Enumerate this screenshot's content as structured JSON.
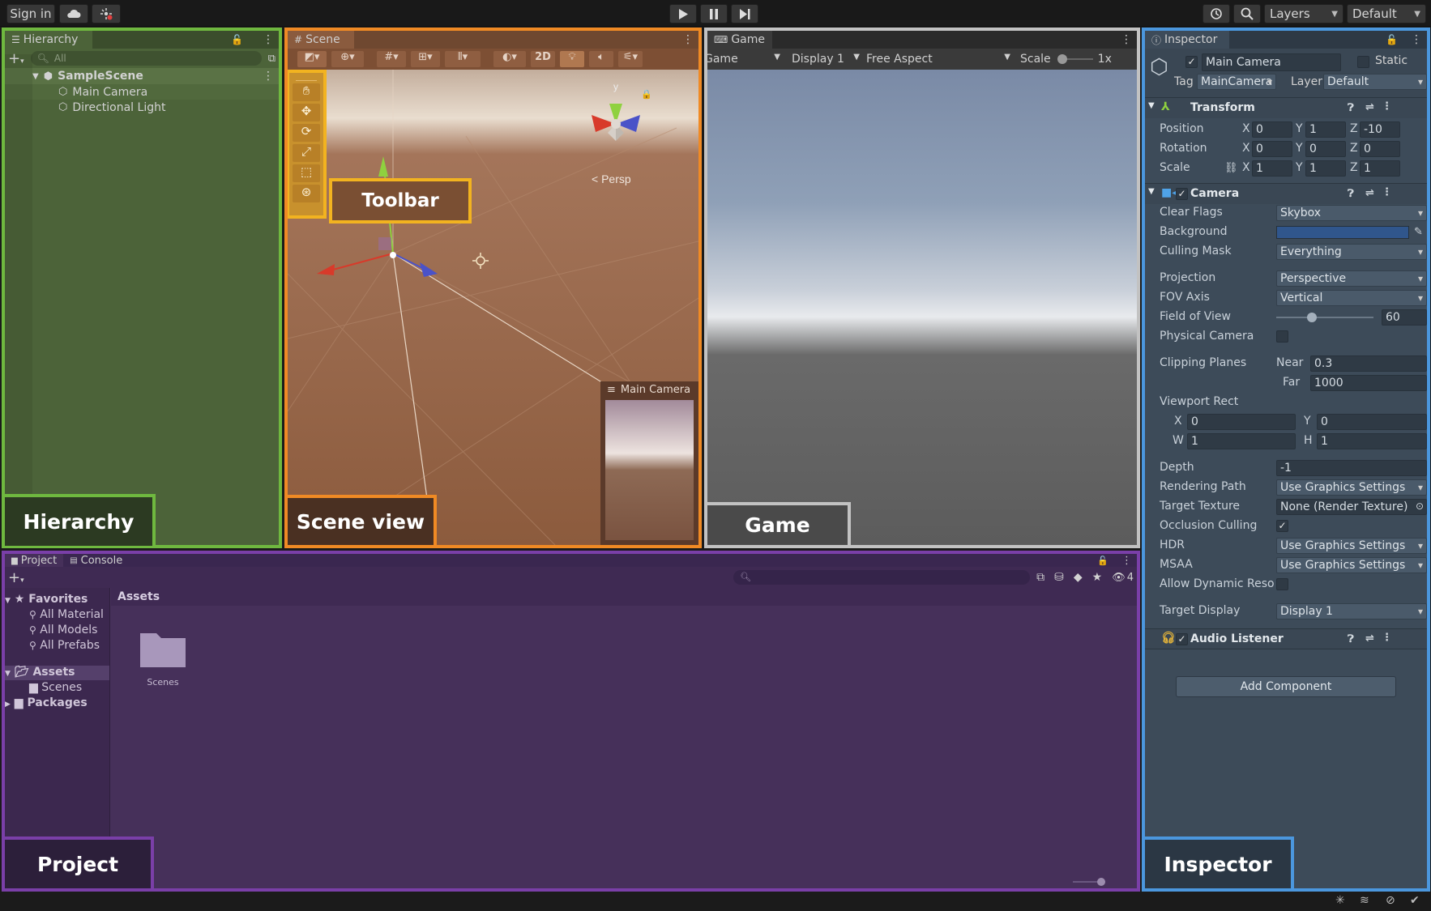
{
  "topbar": {
    "sign_in": "Sign in",
    "cloud_icon": "cloud-icon",
    "collab_icon": "collab-icon",
    "layers": "Layers",
    "layout": "Default"
  },
  "hierarchy": {
    "tab": "Hierarchy",
    "search_placeholder": "All",
    "scene": "SampleScene",
    "items": [
      "Main Camera",
      "Directional Light"
    ],
    "highlight_label": "Hierarchy",
    "accent": "#6fb83f"
  },
  "scene": {
    "tab": "Scene",
    "btn_2d": "2D",
    "persp": "Persp",
    "gizmo_y": "y",
    "cam_preview_title": "Main Camera",
    "toolbar_label": "Toolbar",
    "highlight_label": "Scene view",
    "accent": "#f08a24"
  },
  "game": {
    "tab": "Game",
    "mode": "Game",
    "display": "Display 1",
    "aspect": "Free Aspect",
    "scale_label": "Scale",
    "scale_value": "1x",
    "highlight_label": "Game"
  },
  "inspector": {
    "tab": "Inspector",
    "object_name": "Main Camera",
    "static_label": "Static",
    "tag_label": "Tag",
    "tag_value": "MainCamera",
    "layer_label": "Layer",
    "layer_value": "Default",
    "transform": {
      "title": "Transform",
      "position_label": "Position",
      "px": "0",
      "py": "1",
      "pz": "-10",
      "rotation_label": "Rotation",
      "rx": "0",
      "ry": "0",
      "rz": "0",
      "scale_label": "Scale",
      "sx": "1",
      "sy": "1",
      "sz": "1"
    },
    "camera": {
      "title": "Camera",
      "clear_flags_label": "Clear Flags",
      "clear_flags": "Skybox",
      "background_label": "Background",
      "culling_mask_label": "Culling Mask",
      "culling_mask": "Everything",
      "projection_label": "Projection",
      "projection": "Perspective",
      "fov_axis_label": "FOV Axis",
      "fov_axis": "Vertical",
      "fov_label": "Field of View",
      "fov": "60",
      "physical_label": "Physical Camera",
      "clipping_label": "Clipping Planes",
      "near_label": "Near",
      "near": "0.3",
      "far_label": "Far",
      "far": "1000",
      "viewport_label": "Viewport Rect",
      "vx": "0",
      "vy": "0",
      "vw": "1",
      "vh": "1",
      "depth_label": "Depth",
      "depth": "-1",
      "rendering_label": "Rendering Path",
      "rendering": "Use Graphics Settings",
      "target_texture_label": "Target Texture",
      "target_texture": "None (Render Texture)",
      "occlusion_label": "Occlusion Culling",
      "hdr_label": "HDR",
      "hdr": "Use Graphics Settings",
      "msaa_label": "MSAA",
      "msaa": "Use Graphics Settings",
      "dynamic_label": "Allow Dynamic Reso",
      "target_display_label": "Target Display",
      "target_display": "Display 1"
    },
    "audio_listener": "Audio Listener",
    "add_component": "Add Component",
    "highlight_label": "Inspector",
    "accent": "#4b97de"
  },
  "project": {
    "tab_project": "Project",
    "tab_console": "Console",
    "favorites": "Favorites",
    "fav_items": [
      "All Material",
      "All Models",
      "All Prefabs"
    ],
    "assets": "Assets",
    "assets_children": [
      "Scenes"
    ],
    "packages": "Packages",
    "breadcrumb": "Assets",
    "folder_name": "Scenes",
    "hidden_count": "4",
    "highlight_label": "Project",
    "accent": "#7a3fa8"
  }
}
